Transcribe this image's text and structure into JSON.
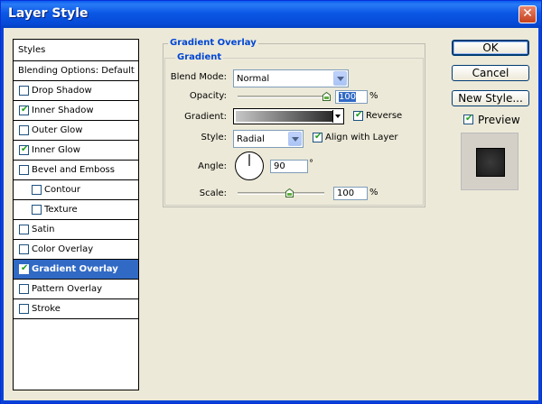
{
  "window": {
    "title": "Layer Style",
    "close_glyph": "✕"
  },
  "styles_panel": {
    "header": "Styles",
    "items": [
      {
        "label": "Blending Options: Default",
        "has_checkbox": false,
        "checked": false,
        "indent": false,
        "selected": false
      },
      {
        "label": "Drop Shadow",
        "has_checkbox": true,
        "checked": false,
        "indent": false,
        "selected": false
      },
      {
        "label": "Inner Shadow",
        "has_checkbox": true,
        "checked": true,
        "indent": false,
        "selected": false
      },
      {
        "label": "Outer Glow",
        "has_checkbox": true,
        "checked": false,
        "indent": false,
        "selected": false
      },
      {
        "label": "Inner Glow",
        "has_checkbox": true,
        "checked": true,
        "indent": false,
        "selected": false
      },
      {
        "label": "Bevel and Emboss",
        "has_checkbox": true,
        "checked": false,
        "indent": false,
        "selected": false
      },
      {
        "label": "Contour",
        "has_checkbox": true,
        "checked": false,
        "indent": true,
        "selected": false
      },
      {
        "label": "Texture",
        "has_checkbox": true,
        "checked": false,
        "indent": true,
        "selected": false
      },
      {
        "label": "Satin",
        "has_checkbox": true,
        "checked": false,
        "indent": false,
        "selected": false
      },
      {
        "label": "Color Overlay",
        "has_checkbox": true,
        "checked": false,
        "indent": false,
        "selected": false
      },
      {
        "label": "Gradient Overlay",
        "has_checkbox": true,
        "checked": true,
        "indent": false,
        "selected": true
      },
      {
        "label": "Pattern Overlay",
        "has_checkbox": true,
        "checked": false,
        "indent": false,
        "selected": false
      },
      {
        "label": "Stroke",
        "has_checkbox": true,
        "checked": false,
        "indent": false,
        "selected": false
      }
    ]
  },
  "panel": {
    "title": "Gradient Overlay",
    "group_title": "Gradient",
    "blend_mode": {
      "label": "Blend Mode:",
      "value": "Normal"
    },
    "opacity": {
      "label": "Opacity:",
      "value": "100",
      "unit": "%",
      "slider_fraction": 1.0
    },
    "gradient": {
      "label": "Gradient:",
      "from_color": "#c8c8c8",
      "to_color": "#2a2a2a"
    },
    "reverse": {
      "label": "Reverse",
      "checked": true
    },
    "style": {
      "label": "Style:",
      "value": "Radial"
    },
    "align_with_layer": {
      "label": "Align with Layer",
      "checked": true
    },
    "angle": {
      "label": "Angle:",
      "value": "90",
      "unit": "°",
      "degrees": 90
    },
    "scale": {
      "label": "Scale:",
      "value": "100",
      "unit": "%",
      "slider_fraction": 0.6
    }
  },
  "buttons": {
    "ok": "OK",
    "cancel": "Cancel",
    "new_style": "New Style..."
  },
  "preview": {
    "label": "Preview",
    "checked": true
  },
  "colors": {
    "accent": "#316ac5",
    "group_title": "#0046d5",
    "check": "#21a121",
    "title_bar": "#0a5cf0"
  }
}
